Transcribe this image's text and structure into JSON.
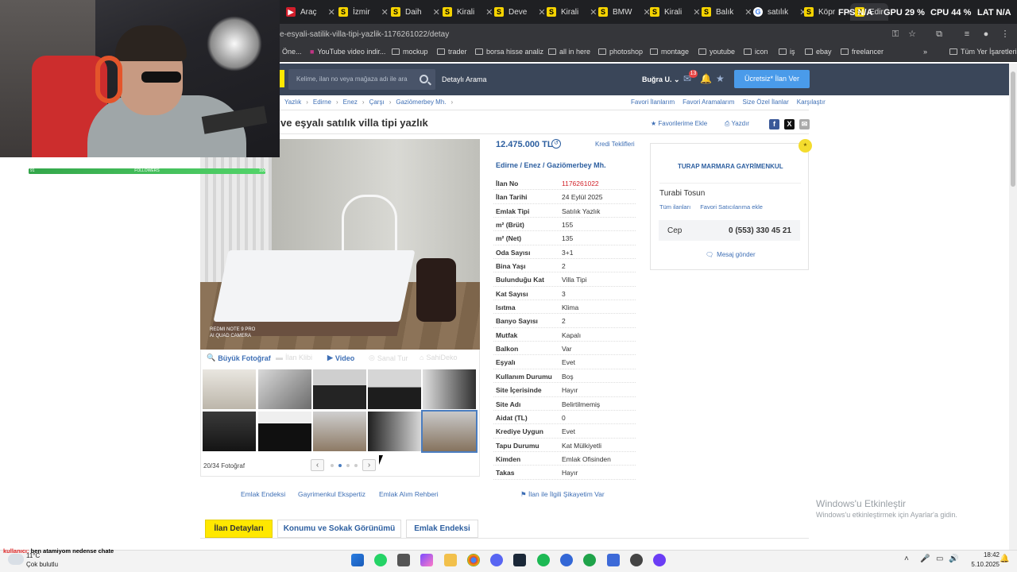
{
  "browser": {
    "tabs": [
      {
        "label": "Araç",
        "icon": "red"
      },
      {
        "label": "İzmir",
        "icon": "s"
      },
      {
        "label": "Daih",
        "icon": "s"
      },
      {
        "label": "Kirali",
        "icon": "s"
      },
      {
        "label": "Deve",
        "icon": "s"
      },
      {
        "label": "Kirali",
        "icon": "s"
      },
      {
        "label": "BMW",
        "icon": "s"
      },
      {
        "label": "Kirali",
        "icon": "s"
      },
      {
        "label": "Balık",
        "icon": "s"
      },
      {
        "label": "satılık",
        "icon": "g"
      },
      {
        "label": "Köpr",
        "icon": "s"
      },
      {
        "label": "Edir",
        "icon": "s"
      }
    ],
    "perf": {
      "fps": "FPS N/A",
      "gpu": "GPU 29 %",
      "cpu": "CPU 44 %",
      "lat": "LAT N/A"
    },
    "url": "e-esyali-satilik-villa-tipi-yazlik-1176261022/detay",
    "bookmarks": [
      "Öne...",
      "YouTube video indir...",
      "mockup",
      "trader",
      "borsa hisse analiz",
      "all in here",
      "photoshop",
      "montage",
      "youtube",
      "icon",
      "iş",
      "ebay",
      "freelancer"
    ],
    "all_bookmarks": "Tüm Yer İşaretleri"
  },
  "header": {
    "search_placeholder": "Kelime, ilan no veya mağaza adı ile ara",
    "detayli": "Detaylı Arama",
    "user": "Buğra U.",
    "notif_count": "13",
    "post_button": "Ücretsiz* İlan Ver"
  },
  "breadcrumbs": [
    "Yazlık",
    "Edirne",
    "Enez",
    "Çarşı",
    "Gaziömerbey Mh."
  ],
  "top_links": [
    "Favori İlanlarım",
    "Favori Aramalarım",
    "Size Özel İlanlar",
    "Karşılaştır"
  ],
  "listing": {
    "title": "ve eşyalı satılık villa tipi yazlık",
    "fav": "Favorilerime Ekle",
    "print": "Yazdır",
    "price": "12.475.000 TL",
    "kredi": "Kredi Teklifleri",
    "location": [
      "Edirne",
      "Enez",
      "Gaziömerbey Mh."
    ],
    "photo_label": "REDMI NOTE 9 PRO\nAI QUAD CAMERA",
    "photo_tabs": {
      "big": "Büyük Fotoğraf",
      "clip": "İlan Klibi",
      "video": "Video",
      "tour": "Sanal Tur",
      "sahibi": "SahiDeko"
    },
    "photo_count": "20/34 Fotoğraf",
    "details": [
      {
        "k": "İlan No",
        "v": "1176261022",
        "red": true
      },
      {
        "k": "İlan Tarihi",
        "v": "24 Eylül 2025"
      },
      {
        "k": "Emlak Tipi",
        "v": "Satılık Yazlık"
      },
      {
        "k": "m² (Brüt)",
        "v": "155"
      },
      {
        "k": "m² (Net)",
        "v": "135"
      },
      {
        "k": "Oda Sayısı",
        "v": "3+1"
      },
      {
        "k": "Bina Yaşı",
        "v": "2"
      },
      {
        "k": "Bulunduğu Kat",
        "v": "Villa Tipi"
      },
      {
        "k": "Kat Sayısı",
        "v": "3"
      },
      {
        "k": "Isıtma",
        "v": "Klima"
      },
      {
        "k": "Banyo Sayısı",
        "v": "2"
      },
      {
        "k": "Mutfak",
        "v": "Kapalı"
      },
      {
        "k": "Balkon",
        "v": "Var"
      },
      {
        "k": "Eşyalı",
        "v": "Evet"
      },
      {
        "k": "Kullanım Durumu",
        "v": "Boş"
      },
      {
        "k": "Site İçerisinde",
        "v": "Hayır"
      },
      {
        "k": "Site Adı",
        "v": "Belirtilmemiş"
      },
      {
        "k": "Aidat (TL)",
        "v": "0"
      },
      {
        "k": "Krediye Uygun",
        "v": "Evet"
      },
      {
        "k": "Tapu Durumu",
        "v": "Kat Mülkiyetli"
      },
      {
        "k": "Kimden",
        "v": "Emlak Ofisinden"
      },
      {
        "k": "Takas",
        "v": "Hayır"
      }
    ]
  },
  "seller": {
    "company": "TURAP MARMARA GAYRİMENKUL",
    "person": "Turabi Tosun",
    "all_listings": "Tüm ilanları",
    "fav_seller": "Favori Satıcılarıma ekle",
    "cep_label": "Cep",
    "phone": "0 (553) 330 45 21",
    "message": "Mesaj gönder"
  },
  "bottom_links": [
    "Emlak Endeksi",
    "Gayrimenkul Ekspertiz",
    "Emlak Alım Rehberi"
  ],
  "complaint": "İlan ile İlgili Şikayetim Var",
  "detail_tabs": [
    "İlan Detayları",
    "Konumu ve Sokak Görünümü",
    "Emlak Endeksi"
  ],
  "watermark": {
    "line1": "Windows'u Etkinleştir",
    "line2": "Windows'u etkinleştirmek için Ayarlar'a gidin."
  },
  "overlay": {
    "follow_label": "FOLLOWERS",
    "follow_left": "91",
    "follow_right": "100"
  },
  "taskbar": {
    "chat_nick": "kullanıcı:",
    "chat_msg": "ben atamiyom nedense chate",
    "weather_temp": "11°C",
    "weather_desc": "Çok bulutlu",
    "time": "18:42",
    "date": "5.10.2025"
  },
  "colors": {
    "accent": "#3e6fb5",
    "header": "#3a4659",
    "yellow": "#ffe800",
    "cta": "#4a9bea"
  }
}
